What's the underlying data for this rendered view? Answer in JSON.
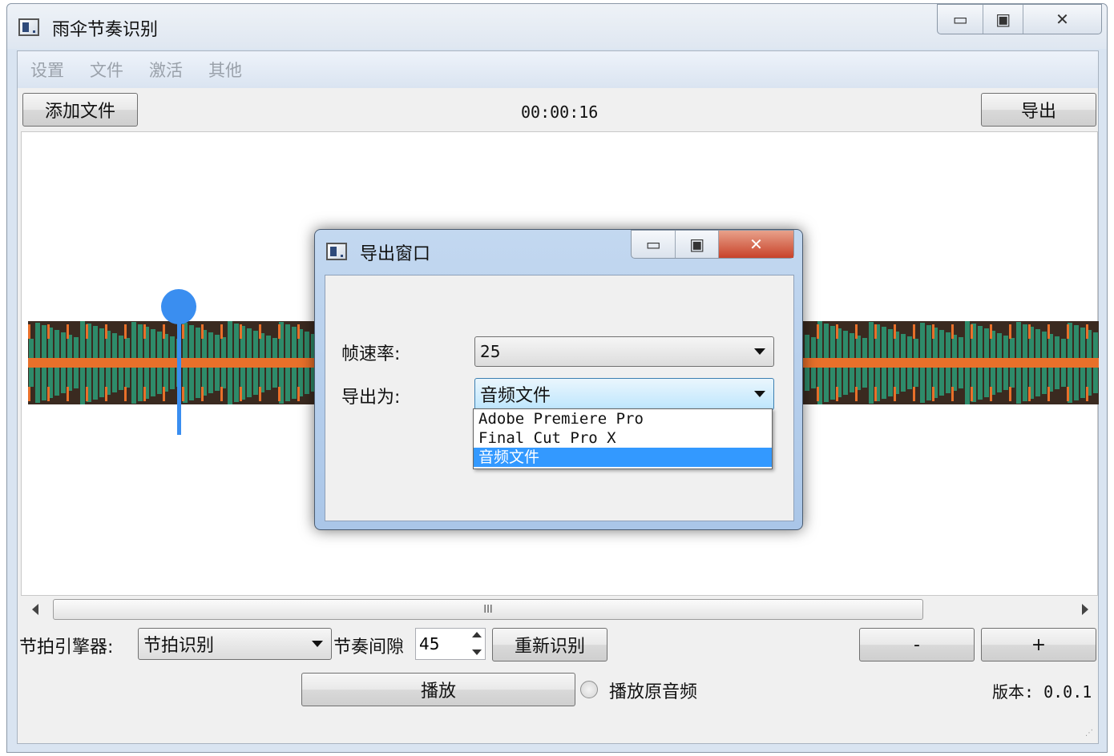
{
  "window": {
    "title": "雨伞节奏识别",
    "minimize_glyph": "▭",
    "maximize_glyph": "▣",
    "close_glyph": "✕"
  },
  "menu": {
    "items": [
      "设置",
      "文件",
      "激活",
      "其他"
    ]
  },
  "toolbar": {
    "add_file_label": "添加文件",
    "time": "00:00:16",
    "export_label": "导出"
  },
  "scrollbar": {
    "grip": "III"
  },
  "controls": {
    "engine_label": "节拍引擎器:",
    "engine_value": "节拍识别",
    "interval_label": "节奏间隙",
    "interval_value": "45",
    "redetect_label": "重新识别",
    "minus_label": "-",
    "plus_label": "+",
    "play_label": "播放",
    "play_original_label": "播放原音频",
    "version": "版本: 0.0.1"
  },
  "dialog": {
    "title": "导出窗口",
    "framerate_label": "帧速率:",
    "framerate_value": "25",
    "export_as_label": "导出为:",
    "export_as_value": "音频文件",
    "options": [
      "Adobe Premiere Pro",
      "Final Cut Pro X",
      "音频文件"
    ],
    "selected_option": "音频文件"
  },
  "colors": {
    "accent": "#3a8ef0",
    "wave_green": "#2e8b6a",
    "wave_orange": "#e8702a",
    "selection": "#3399ff"
  }
}
